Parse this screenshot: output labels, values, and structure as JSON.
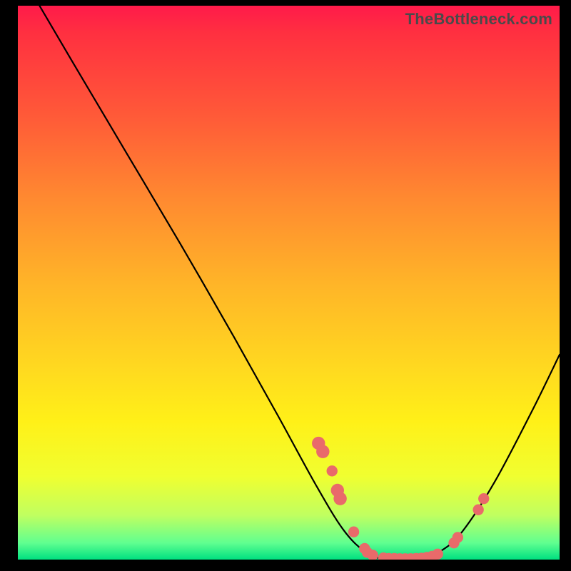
{
  "watermark": "TheBottleneck.com",
  "chart_data": {
    "type": "line",
    "title": "",
    "xlabel": "",
    "ylabel": "",
    "xlim": [
      0,
      100
    ],
    "ylim": [
      0,
      100
    ],
    "curve_points": [
      {
        "x": 4.0,
        "y": 100.0
      },
      {
        "x": 10.0,
        "y": 90.0
      },
      {
        "x": 20.0,
        "y": 73.5
      },
      {
        "x": 30.0,
        "y": 57.0
      },
      {
        "x": 40.0,
        "y": 40.0
      },
      {
        "x": 48.0,
        "y": 26.0
      },
      {
        "x": 55.0,
        "y": 13.5
      },
      {
        "x": 60.0,
        "y": 5.5
      },
      {
        "x": 64.0,
        "y": 1.5
      },
      {
        "x": 68.0,
        "y": 0.0
      },
      {
        "x": 74.0,
        "y": 0.0
      },
      {
        "x": 78.0,
        "y": 1.5
      },
      {
        "x": 82.0,
        "y": 5.0
      },
      {
        "x": 88.0,
        "y": 14.0
      },
      {
        "x": 95.0,
        "y": 27.0
      },
      {
        "x": 100.0,
        "y": 37.0
      }
    ],
    "markers": [
      {
        "x": 55.5,
        "y": 21.0,
        "r": 1.2
      },
      {
        "x": 56.3,
        "y": 19.5,
        "r": 1.2
      },
      {
        "x": 58.0,
        "y": 16.0,
        "r": 1.0
      },
      {
        "x": 59.0,
        "y": 12.5,
        "r": 1.2
      },
      {
        "x": 59.5,
        "y": 11.0,
        "r": 1.2
      },
      {
        "x": 62.0,
        "y": 5.0,
        "r": 1.0
      },
      {
        "x": 64.0,
        "y": 2.0,
        "r": 1.0
      },
      {
        "x": 64.5,
        "y": 1.3,
        "r": 1.0
      },
      {
        "x": 65.5,
        "y": 0.8,
        "r": 1.0
      },
      {
        "x": 67.5,
        "y": 0.3,
        "r": 1.0
      },
      {
        "x": 68.5,
        "y": 0.2,
        "r": 1.0
      },
      {
        "x": 69.5,
        "y": 0.2,
        "r": 1.0
      },
      {
        "x": 70.5,
        "y": 0.15,
        "r": 1.0
      },
      {
        "x": 71.5,
        "y": 0.15,
        "r": 1.0
      },
      {
        "x": 72.5,
        "y": 0.15,
        "r": 1.0
      },
      {
        "x": 73.5,
        "y": 0.2,
        "r": 1.0
      },
      {
        "x": 74.5,
        "y": 0.25,
        "r": 1.0
      },
      {
        "x": 75.5,
        "y": 0.4,
        "r": 1.0
      },
      {
        "x": 76.5,
        "y": 0.6,
        "r": 1.0
      },
      {
        "x": 77.5,
        "y": 1.0,
        "r": 1.0
      },
      {
        "x": 80.5,
        "y": 3.0,
        "r": 1.0
      },
      {
        "x": 81.2,
        "y": 4.0,
        "r": 1.0
      },
      {
        "x": 85.0,
        "y": 9.0,
        "r": 1.0
      },
      {
        "x": 86.0,
        "y": 11.0,
        "r": 1.0
      }
    ]
  }
}
